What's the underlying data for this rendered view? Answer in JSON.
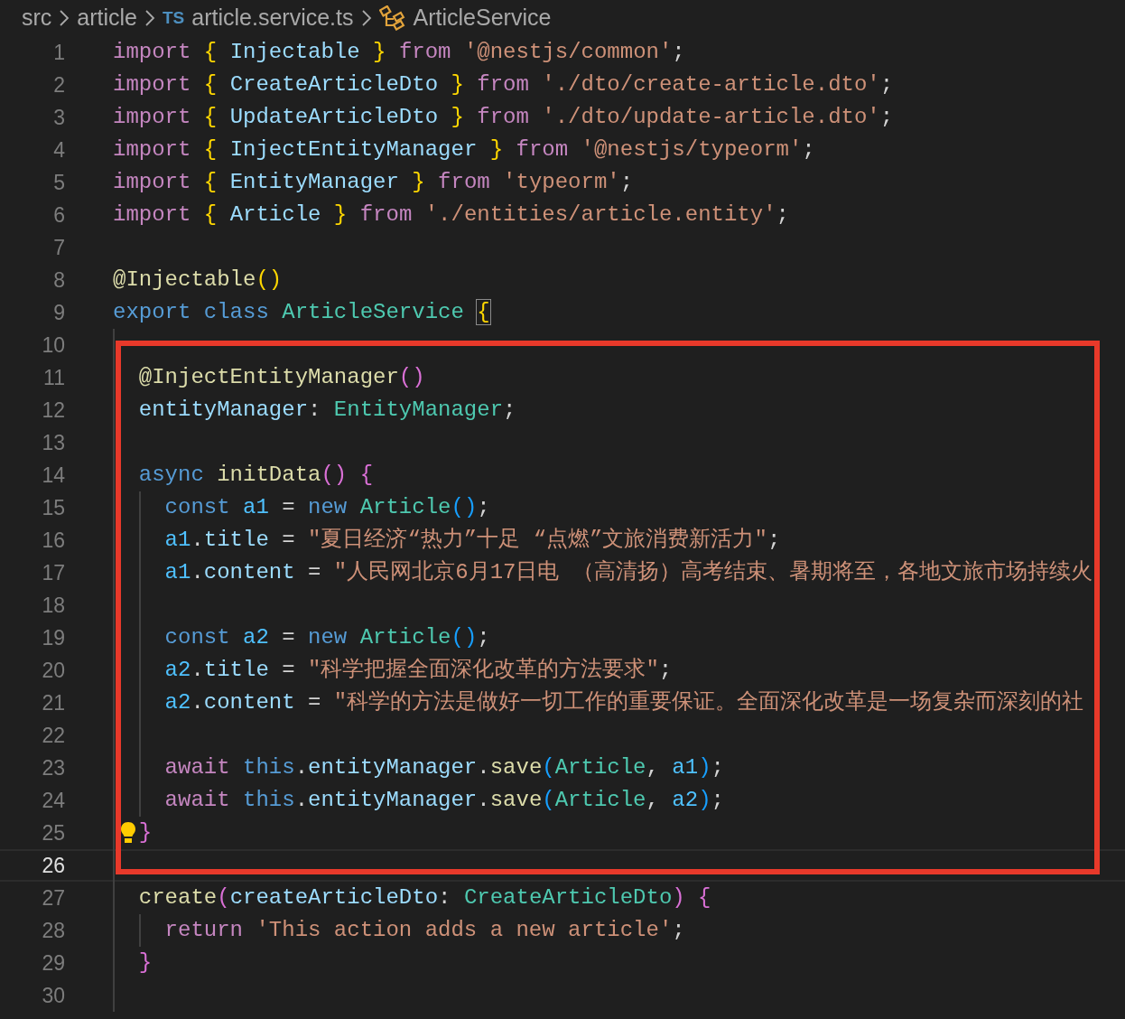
{
  "breadcrumb": [
    {
      "kind": "folder",
      "label": "src"
    },
    {
      "kind": "folder",
      "label": "article"
    },
    {
      "kind": "file",
      "badge": "TS",
      "label": "article.service.ts"
    },
    {
      "kind": "class",
      "label": "ArticleService"
    }
  ],
  "lines": [
    {
      "number": "1",
      "current": false,
      "tokens": [
        {
          "text": "import ",
          "kind": "kw"
        },
        {
          "text": "{ ",
          "kind": "b1"
        },
        {
          "text": "Injectable ",
          "kind": "var"
        },
        {
          "text": "} ",
          "kind": "b1"
        },
        {
          "text": "from ",
          "kind": "kw"
        },
        {
          "text": "'@nestjs/common'",
          "kind": "str"
        },
        {
          "text": ";",
          "kind": "plain"
        }
      ]
    },
    {
      "number": "2",
      "current": false,
      "tokens": [
        {
          "text": "import ",
          "kind": "kw"
        },
        {
          "text": "{ ",
          "kind": "b1"
        },
        {
          "text": "CreateArticleDto ",
          "kind": "var"
        },
        {
          "text": "} ",
          "kind": "b1"
        },
        {
          "text": "from ",
          "kind": "kw"
        },
        {
          "text": "'./dto/create-article.dto'",
          "kind": "str"
        },
        {
          "text": ";",
          "kind": "plain"
        }
      ]
    },
    {
      "number": "3",
      "current": false,
      "tokens": [
        {
          "text": "import ",
          "kind": "kw"
        },
        {
          "text": "{ ",
          "kind": "b1"
        },
        {
          "text": "UpdateArticleDto ",
          "kind": "var"
        },
        {
          "text": "} ",
          "kind": "b1"
        },
        {
          "text": "from ",
          "kind": "kw"
        },
        {
          "text": "'./dto/update-article.dto'",
          "kind": "str"
        },
        {
          "text": ";",
          "kind": "plain"
        }
      ]
    },
    {
      "number": "4",
      "current": false,
      "tokens": [
        {
          "text": "import ",
          "kind": "kw"
        },
        {
          "text": "{ ",
          "kind": "b1"
        },
        {
          "text": "InjectEntityManager ",
          "kind": "var"
        },
        {
          "text": "} ",
          "kind": "b1"
        },
        {
          "text": "from ",
          "kind": "kw"
        },
        {
          "text": "'@nestjs/typeorm'",
          "kind": "str"
        },
        {
          "text": ";",
          "kind": "plain"
        }
      ]
    },
    {
      "number": "5",
      "current": false,
      "tokens": [
        {
          "text": "import ",
          "kind": "kw"
        },
        {
          "text": "{ ",
          "kind": "b1"
        },
        {
          "text": "EntityManager ",
          "kind": "var"
        },
        {
          "text": "} ",
          "kind": "b1"
        },
        {
          "text": "from ",
          "kind": "kw"
        },
        {
          "text": "'typeorm'",
          "kind": "str"
        },
        {
          "text": ";",
          "kind": "plain"
        }
      ]
    },
    {
      "number": "6",
      "current": false,
      "tokens": [
        {
          "text": "import ",
          "kind": "kw"
        },
        {
          "text": "{ ",
          "kind": "b1"
        },
        {
          "text": "Article ",
          "kind": "var"
        },
        {
          "text": "} ",
          "kind": "b1"
        },
        {
          "text": "from ",
          "kind": "kw"
        },
        {
          "text": "'./entities/article.entity'",
          "kind": "str"
        },
        {
          "text": ";",
          "kind": "plain"
        }
      ]
    },
    {
      "number": "7",
      "current": false
    },
    {
      "number": "8",
      "current": false,
      "tokens": [
        {
          "text": "@Injectable",
          "kind": "fn"
        },
        {
          "text": "()",
          "kind": "b1"
        }
      ]
    },
    {
      "number": "9",
      "current": false,
      "tokens": [
        {
          "text": "export class ",
          "kind": "storage"
        },
        {
          "text": "ArticleService ",
          "kind": "type"
        },
        {
          "text": "{",
          "kind": "match"
        }
      ]
    },
    {
      "number": "10",
      "current": false
    },
    {
      "number": "11",
      "current": false,
      "tokens": [
        {
          "text": "  @InjectEntityManager",
          "kind": "fn"
        },
        {
          "text": "()",
          "kind": "b2"
        }
      ]
    },
    {
      "number": "12",
      "current": false,
      "tokens": [
        {
          "text": "  entityManager",
          "kind": "var"
        },
        {
          "text": ": ",
          "kind": "plain"
        },
        {
          "text": "EntityManager",
          "kind": "type"
        },
        {
          "text": ";",
          "kind": "plain"
        }
      ]
    },
    {
      "number": "13",
      "current": false
    },
    {
      "number": "14",
      "current": false,
      "tokens": [
        {
          "text": "  async ",
          "kind": "storage"
        },
        {
          "text": "initData",
          "kind": "fn"
        },
        {
          "text": "() {",
          "kind": "b2"
        }
      ]
    },
    {
      "number": "15",
      "current": false,
      "tokens": [
        {
          "text": "    const ",
          "kind": "storage"
        },
        {
          "text": "a1 ",
          "kind": "const"
        },
        {
          "text": "= ",
          "kind": "plain"
        },
        {
          "text": "new ",
          "kind": "storage"
        },
        {
          "text": "Article",
          "kind": "type"
        },
        {
          "text": "()",
          "kind": "b3"
        },
        {
          "text": ";",
          "kind": "plain"
        }
      ]
    },
    {
      "number": "16",
      "current": false,
      "tokens": [
        {
          "text": "    a1",
          "kind": "const"
        },
        {
          "text": ".",
          "kind": "plain"
        },
        {
          "text": "title",
          "kind": "var"
        },
        {
          "text": " = ",
          "kind": "plain"
        },
        {
          "text": "\"夏日经济“热力”十足 “点燃”文旅消费新活力\"",
          "kind": "str"
        },
        {
          "text": ";",
          "kind": "plain"
        }
      ]
    },
    {
      "number": "17",
      "current": false,
      "tokens": [
        {
          "text": "    a1",
          "kind": "const"
        },
        {
          "text": ".",
          "kind": "plain"
        },
        {
          "text": "content",
          "kind": "var"
        },
        {
          "text": " = ",
          "kind": "plain"
        },
        {
          "text": "\"人民网北京6月17日电 （高清扬）高考结束、暑期将至，各地文旅市场持续火",
          "kind": "str"
        }
      ]
    },
    {
      "number": "18",
      "current": false
    },
    {
      "number": "19",
      "current": false,
      "tokens": [
        {
          "text": "    const ",
          "kind": "storage"
        },
        {
          "text": "a2 ",
          "kind": "const"
        },
        {
          "text": "= ",
          "kind": "plain"
        },
        {
          "text": "new ",
          "kind": "storage"
        },
        {
          "text": "Article",
          "kind": "type"
        },
        {
          "text": "()",
          "kind": "b3"
        },
        {
          "text": ";",
          "kind": "plain"
        }
      ]
    },
    {
      "number": "20",
      "current": false,
      "tokens": [
        {
          "text": "    a2",
          "kind": "const"
        },
        {
          "text": ".",
          "kind": "plain"
        },
        {
          "text": "title",
          "kind": "var"
        },
        {
          "text": " = ",
          "kind": "plain"
        },
        {
          "text": "\"科学把握全面深化改革的方法要求\"",
          "kind": "str"
        },
        {
          "text": ";",
          "kind": "plain"
        }
      ]
    },
    {
      "number": "21",
      "current": false,
      "tokens": [
        {
          "text": "    a2",
          "kind": "const"
        },
        {
          "text": ".",
          "kind": "plain"
        },
        {
          "text": "content",
          "kind": "var"
        },
        {
          "text": " = ",
          "kind": "plain"
        },
        {
          "text": "\"科学的方法是做好一切工作的重要保证。全面深化改革是一场复杂而深刻的社",
          "kind": "str"
        }
      ]
    },
    {
      "number": "22",
      "current": false
    },
    {
      "number": "23",
      "current": false,
      "tokens": [
        {
          "text": "    await ",
          "kind": "kw"
        },
        {
          "text": "this",
          "kind": "storage"
        },
        {
          "text": ".",
          "kind": "plain"
        },
        {
          "text": "entityManager",
          "kind": "var"
        },
        {
          "text": ".",
          "kind": "plain"
        },
        {
          "text": "save",
          "kind": "fn"
        },
        {
          "text": "(",
          "kind": "b3"
        },
        {
          "text": "Article",
          "kind": "type"
        },
        {
          "text": ", ",
          "kind": "plain"
        },
        {
          "text": "a1",
          "kind": "const"
        },
        {
          "text": ")",
          "kind": "b3"
        },
        {
          "text": ";",
          "kind": "plain"
        }
      ]
    },
    {
      "number": "24",
      "current": false,
      "tokens": [
        {
          "text": "    await ",
          "kind": "kw"
        },
        {
          "text": "this",
          "kind": "storage"
        },
        {
          "text": ".",
          "kind": "plain"
        },
        {
          "text": "entityManager",
          "kind": "var"
        },
        {
          "text": ".",
          "kind": "plain"
        },
        {
          "text": "save",
          "kind": "fn"
        },
        {
          "text": "(",
          "kind": "b3"
        },
        {
          "text": "Article",
          "kind": "type"
        },
        {
          "text": ", ",
          "kind": "plain"
        },
        {
          "text": "a2",
          "kind": "const"
        },
        {
          "text": ")",
          "kind": "b3"
        },
        {
          "text": ";",
          "kind": "plain"
        }
      ]
    },
    {
      "number": "25",
      "current": false,
      "lightbulb": true,
      "tokens": [
        {
          "text": "  }",
          "kind": "b2"
        }
      ]
    },
    {
      "number": "26",
      "current": true
    },
    {
      "number": "27",
      "current": false,
      "tokens": [
        {
          "text": "  create",
          "kind": "fn"
        },
        {
          "text": "(",
          "kind": "b2"
        },
        {
          "text": "createArticleDto",
          "kind": "var"
        },
        {
          "text": ": ",
          "kind": "plain"
        },
        {
          "text": "CreateArticleDto",
          "kind": "type"
        },
        {
          "text": ") {",
          "kind": "b2"
        }
      ]
    },
    {
      "number": "28",
      "current": false,
      "tokens": [
        {
          "text": "    return ",
          "kind": "kw"
        },
        {
          "text": "'This action adds a new article'",
          "kind": "str"
        },
        {
          "text": ";",
          "kind": "plain"
        }
      ]
    },
    {
      "number": "29",
      "current": false,
      "tokens": [
        {
          "text": "  }",
          "kind": "b2"
        }
      ]
    },
    {
      "number": "30",
      "current": false
    }
  ]
}
